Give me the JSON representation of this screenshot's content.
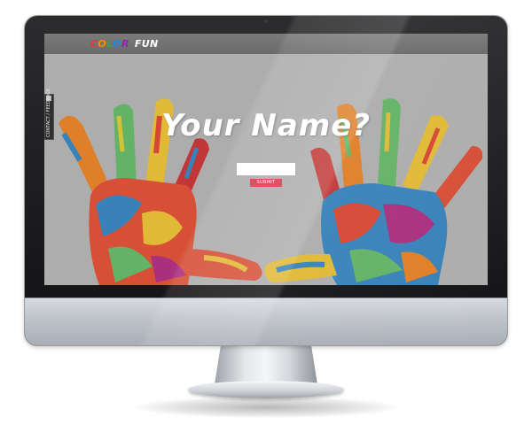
{
  "site": {
    "logo_letters": [
      {
        "char": "C",
        "color": "#e53935"
      },
      {
        "char": "O",
        "color": "#fb8c00"
      },
      {
        "char": "L",
        "color": "#43a047"
      },
      {
        "char": "O",
        "color": "#1e88e5"
      },
      {
        "char": "R",
        "color": "#8e24aa"
      }
    ],
    "logo_suffix": "FUN",
    "side_tab_label": "CONTACT / FEEDBACK"
  },
  "hero": {
    "title": "Your Name?",
    "input_value": "",
    "submit_label": "SUBMIT"
  },
  "colors": {
    "accent": "#e0344b",
    "header": "#707070",
    "screen_bg": "#b9b9b9"
  }
}
